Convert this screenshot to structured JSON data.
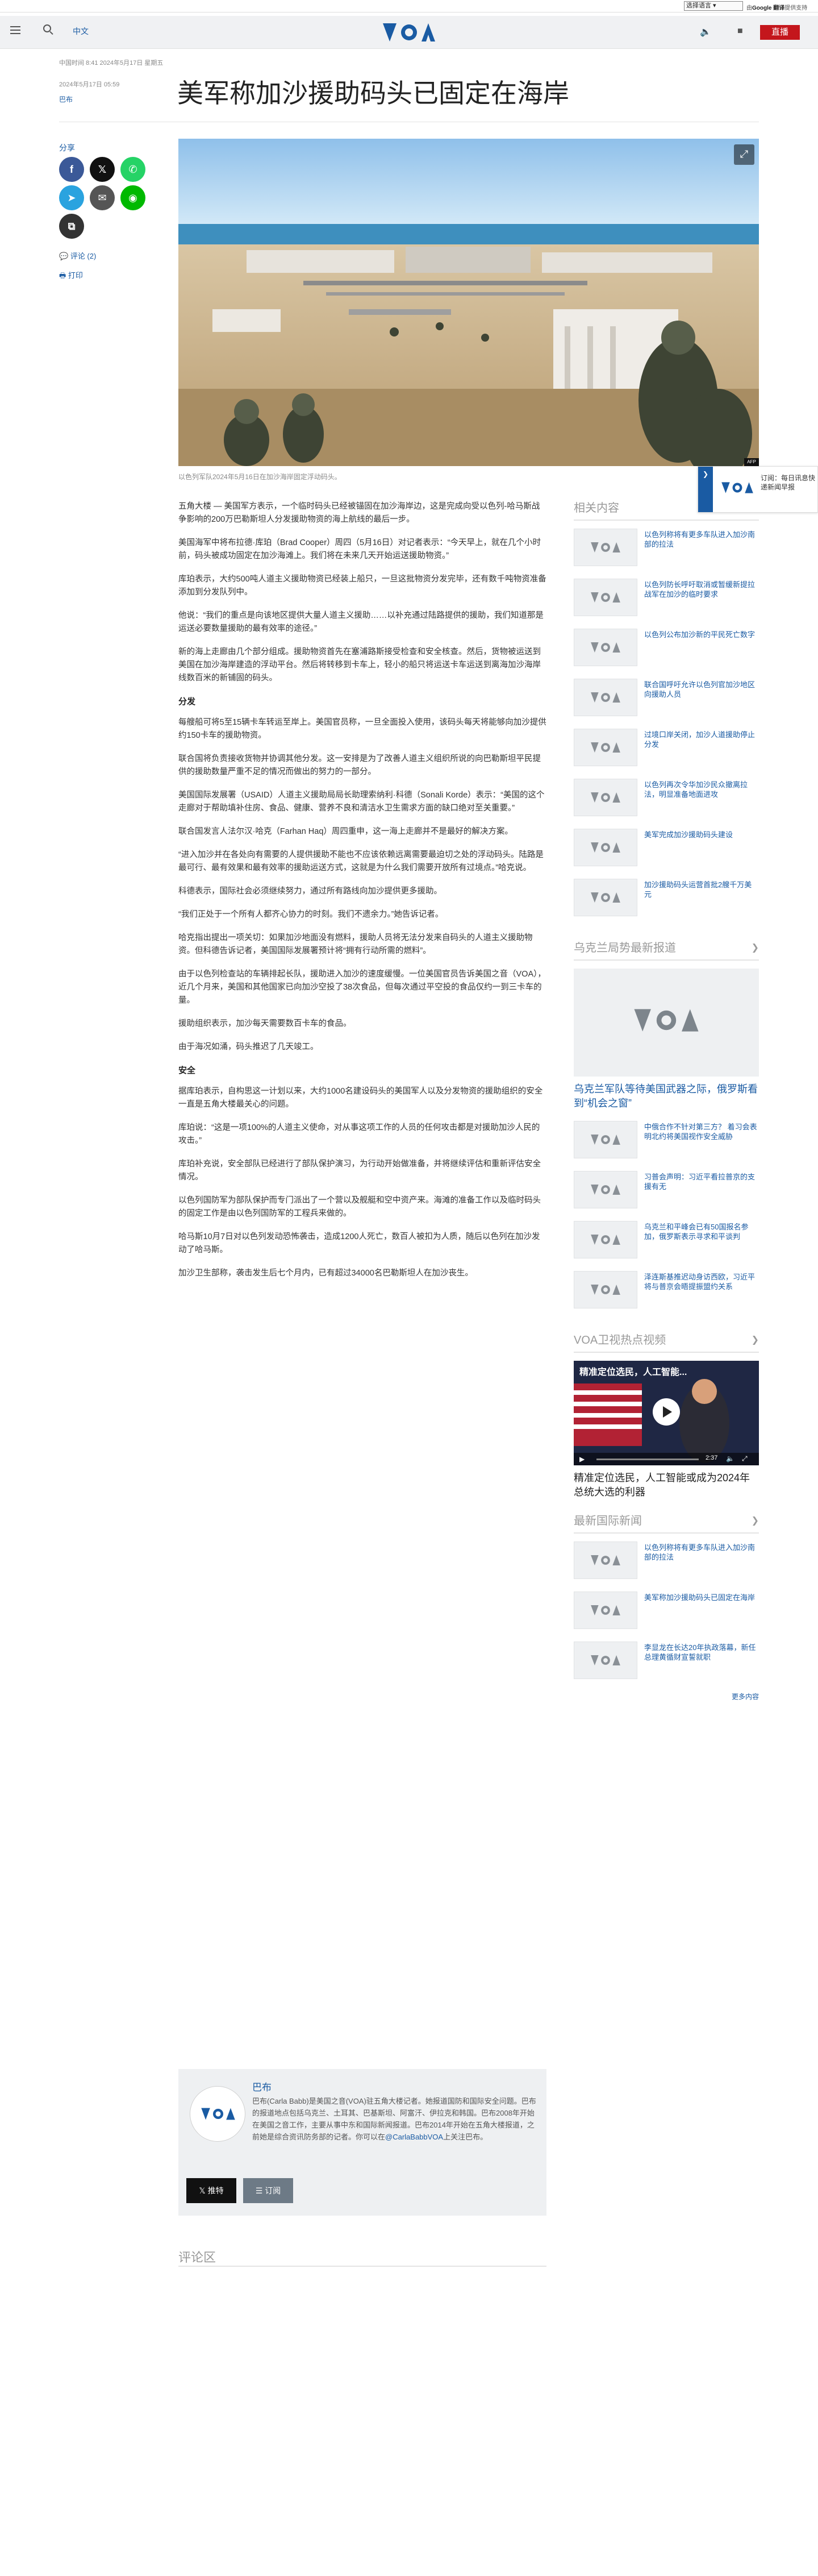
{
  "translate": {
    "select_label": "选择语言",
    "powered_prefix": "由",
    "powered_brand": "Google 翻译",
    "powered_suffix": "提供支持"
  },
  "header": {
    "language": "中文",
    "logo_text": "VOA",
    "live_label": "直播"
  },
  "article": {
    "meta": "中国时间 8:41 2024年5月17日 星期五",
    "date": "2024年5月17日 05:59",
    "author": "巴布",
    "headline": "美军称加沙援助码头已固定在海岸",
    "caption": "以色列军队2024年5月16日在加沙海岸固定浮动码头。",
    "image_credit": "AFP",
    "paragraphs": [
      "五角大楼 — 美国军方表示，一个临时码头已经被锚固在加沙海岸边，这是完成向受以色列-哈马斯战争影响的200万巴勒斯坦人分发援助物资的海上航线的最后一步。",
      "美国海军中将布拉德·库珀（Brad Cooper）周四（5月16日）对记者表示：“今天早上，就在几个小时前，码头被成功固定在加沙海滩上。我们将在未来几天开始运送援助物资。”",
      "库珀表示，大约500吨人道主义援助物资已经装上船只，一旦这批物资分发完毕，还有数千吨物资准备添加到分发队列中。",
      "他说：“我们的重点是向该地区提供大量人道主义援助……以补充通过陆路提供的援助，我们知道那是运送必要数量援助的最有效率的途径。”",
      "新的海上走廊由几个部分组成。援助物资首先在塞浦路斯接受检查和安全核查。然后，货物被运送到美国在加沙海岸建造的浮动平台。然后将转移到卡车上，轻小的船只将运送卡车运送到离海加沙海岸线数百米的新铺固的码头。"
    ],
    "subhead_1": "分发",
    "paragraphs_2": [
      "每艘船可将5至15辆卡车转运至岸上。美国官员称，一旦全面投入使用，该码头每天将能够向加沙提供约150卡车的援助物资。",
      "联合国将负责接收货物并协调其他分发。这一安排是为了改善人道主义组织所说的向巴勒斯坦平民提供的援助数量严重不足的情况而做出的努力的一部分。",
      "美国国际发展署（USAID）人道主义援助局局长助理索纳利·科德（Sonali Korde）表示：“美国的这个走廊对于帮助填补住房、食品、健康、营养不良和清洁水卫生需求方面的缺口绝对至关重要。”",
      "联合国发言人法尔汉·哈克（Farhan Haq）周四重申，这一海上走廊并不是最好的解决方案。",
      "“进入加沙并在各处向有需要的人提供援助不能也不应该依赖远离需要最迫切之处的浮动码头。陆路是最可行、最有效果和最有效率的援助运送方式，这就是为什么我们需要开放所有过境点。”哈克说。",
      "科德表示，国际社会必须继续努力，通过所有路线向加沙提供更多援助。",
      "“我们正处于一个所有人都齐心协力的时刻。我们不遗余力。”她告诉记者。",
      "哈克指出提出一项关切：如果加沙地面没有燃料，援助人员将无法分发来自码头的人道主义援助物资。但科德告诉记者，美国国际发展署预计将“拥有行动所需的燃料”。",
      "由于以色列检查站的车辆排起长队，援助进入加沙的速度缓慢。一位美国官员告诉美国之音（VOA），近几个月来，美国和其他国家已向加沙空投了38次食品，但每次通过平空投的食品仅约一到三卡车的量。",
      "援助组织表示，加沙每天需要数百卡车的食品。",
      "由于海况如涌，码头推迟了几天竣工。"
    ],
    "subhead_2": "安全",
    "paragraphs_3": [
      "据库珀表示，自构思这一计划以来，大约1000名建设码头的美国军人以及分发物资的援助组织的安全一直是五角大楼最关心的问题。",
      "库珀说：“这是一项100%的人道主义使命，对从事这项工作的人员的任何攻击都是对援助加沙人民的攻击。”",
      "库珀补充说，安全部队已经进行了部队保护演习，为行动开始做准备，并将继续评估和重新评估安全情况。",
      "以色列国防军为部队保护而专门派出了一个营以及舰艇和空中资产来。海滩的准备工作以及临时码头的固定工作是由以色列国防军的工程兵来做的。",
      "哈马斯10月7日对以色列发动恐怖袭击，造成1200人死亡，数百人被扣为人质，随后以色列在加沙发动了哈马斯。",
      "加沙卫生部称，袭击发生后七个月内，已有超过34000名巴勒斯坦人在加沙丧生。"
    ]
  },
  "share": {
    "title": "分享",
    "comments_label": "评论 (2)",
    "print_label": "打印"
  },
  "floating_subscribe": {
    "text": "订阅：每日讯息快递新闻早报"
  },
  "author_box": {
    "name": "巴布",
    "bio": "巴布(Carla Babb)是美国之音(VOA)驻五角大楼记者。她报道国防和国际安全问题。巴布的报道地点包括乌克兰、土耳其、巴基斯坦、阿富汗、伊拉克和韩国。巴布2008年开始在美国之音工作，主要从事中东和国际新闻报道。巴布2014年开始在五角大楼报道，之前她是综合资讯防务部的记者。你可以在",
    "handle": "@CarlaBabbVOA",
    "bio_suffix": "上关注巴布。",
    "tweet_label": "推特",
    "subscribe_label": "订阅"
  },
  "comments_title": "评论区",
  "sidebar": {
    "related_title": "相关内容",
    "related": [
      "以色列称将有更多车队进入加沙南部的拉法",
      "以色列防长呼吁取消或暂缓新提拉战军在加沙的临时要求",
      "以色列公布加沙新的平民死亡数字",
      "联合国呼吁允许以色列官加沙地区向援助人员",
      "过境口岸关闭，加沙人道援助停止分发",
      "以色列再次令华加沙民众撤离拉法，明显准备地面进攻",
      "美军完成加沙援助码头建设",
      "加沙援助码头运营首批2艘千万美元"
    ],
    "ukraine_title": "乌克兰局势最新报道",
    "ukraine_card_title": "乌克兰军队等待美国武器之际，俄罗斯看到“机会之窗”",
    "ukraine_items": [
      "中俄合作不针对第三方？ 着习会表明北约将美国视作安全威胁",
      "习普会声明：习近平看拉普京的支援有无",
      "乌克兰和平峰会已有50国报名参加，俄罗斯表示寻求和平谈判",
      "泽连斯基推迟动身访西欧，习近平将与普京会晤提振盟约关系"
    ],
    "video_title": "VOA卫视热点视频",
    "video_banner": "精准定位选民，人工智能...",
    "video_time": "2:37",
    "video_caption": "精准定位选民，人工智能或成为2024年总统大选的利器",
    "intl_title": "最新国际新闻",
    "intl_items": [
      "以色列称将有更多车队进入加沙南部的拉法",
      "美军称加沙援助码头已固定在海岸",
      "李显龙在长达20年执政落幕，新任总理黄循财宣誓就职"
    ],
    "more_label": "更多内容"
  },
  "colors": {
    "brand_blue": "#1a5ba3",
    "live_red": "#c4161c",
    "facebook": "#3b5998",
    "x": "#111111",
    "whatsapp": "#25d366",
    "telegram": "#2aa3df",
    "email": "#555555",
    "line": "#00b900",
    "copy": "#333333"
  }
}
